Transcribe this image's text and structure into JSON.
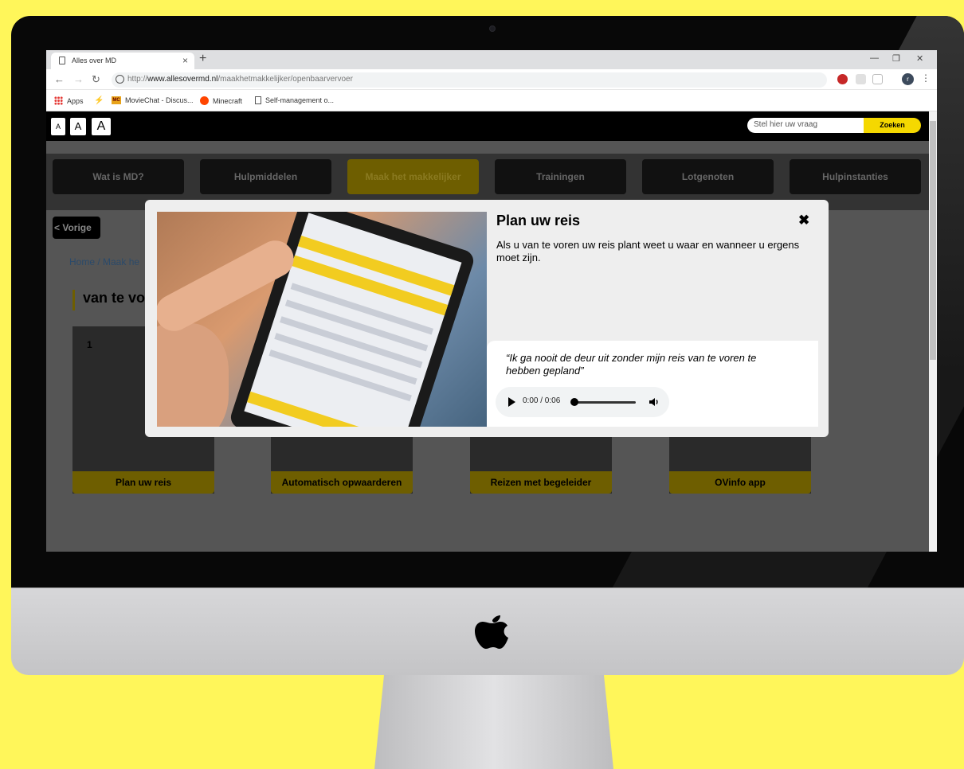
{
  "browser": {
    "tab_title": "Alles over MD",
    "url_prefix": "http://",
    "url_domain": "www.allesovermd.nl",
    "url_path": "/maakhetmakkelijker/openbaarvervoer",
    "bookmarks": [
      "Apps",
      "MovieChat - Discus...",
      "Minecraft",
      "Self-management o..."
    ]
  },
  "site": {
    "font_sizes": [
      "A",
      "A",
      "A"
    ],
    "search_placeholder": "Stel hier uw vraag",
    "search_button": "Zoeken",
    "nav": [
      "Wat is MD?",
      "Hulpmiddelen",
      "Maak het makkelijker",
      "Trainingen",
      "Lotgenoten",
      "Hulpinstanties"
    ],
    "active_nav": "Maak het makkelijker",
    "prev_button": "< Vorige",
    "breadcrumb": "Home / Maak he",
    "heading": "van te vo",
    "cards": [
      {
        "number": "1",
        "label": "Plan uw reis"
      },
      {
        "label": "Automatisch opwaarderen"
      },
      {
        "label": "Reizen met begeleider"
      },
      {
        "label": "OVinfo app"
      }
    ]
  },
  "modal": {
    "title": "Plan uw reis",
    "close": "✖",
    "text": "Als u van te voren uw reis plant weet u waar en wanneer u ergens moet zijn.",
    "quote": "“Ik ga nooit de deur uit zonder mijn reis van te voren te hebben gepland”",
    "audio_time": "0:00 / 0:06",
    "audio_progress": 0.0
  },
  "colors": {
    "background": "#fff65a",
    "accent_yellow": "#f5d800"
  }
}
